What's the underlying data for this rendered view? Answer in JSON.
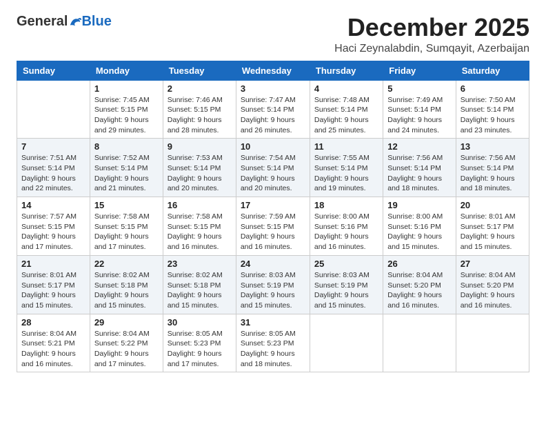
{
  "logo": {
    "general": "General",
    "blue": "Blue"
  },
  "header": {
    "month": "December 2025",
    "location": "Haci Zeynalabdin, Sumqayit, Azerbaijan"
  },
  "weekdays": [
    "Sunday",
    "Monday",
    "Tuesday",
    "Wednesday",
    "Thursday",
    "Friday",
    "Saturday"
  ],
  "weeks": [
    [
      {
        "day": "",
        "info": ""
      },
      {
        "day": "1",
        "info": "Sunrise: 7:45 AM\nSunset: 5:15 PM\nDaylight: 9 hours\nand 29 minutes."
      },
      {
        "day": "2",
        "info": "Sunrise: 7:46 AM\nSunset: 5:15 PM\nDaylight: 9 hours\nand 28 minutes."
      },
      {
        "day": "3",
        "info": "Sunrise: 7:47 AM\nSunset: 5:14 PM\nDaylight: 9 hours\nand 26 minutes."
      },
      {
        "day": "4",
        "info": "Sunrise: 7:48 AM\nSunset: 5:14 PM\nDaylight: 9 hours\nand 25 minutes."
      },
      {
        "day": "5",
        "info": "Sunrise: 7:49 AM\nSunset: 5:14 PM\nDaylight: 9 hours\nand 24 minutes."
      },
      {
        "day": "6",
        "info": "Sunrise: 7:50 AM\nSunset: 5:14 PM\nDaylight: 9 hours\nand 23 minutes."
      }
    ],
    [
      {
        "day": "7",
        "info": "Sunrise: 7:51 AM\nSunset: 5:14 PM\nDaylight: 9 hours\nand 22 minutes."
      },
      {
        "day": "8",
        "info": "Sunrise: 7:52 AM\nSunset: 5:14 PM\nDaylight: 9 hours\nand 21 minutes."
      },
      {
        "day": "9",
        "info": "Sunrise: 7:53 AM\nSunset: 5:14 PM\nDaylight: 9 hours\nand 20 minutes."
      },
      {
        "day": "10",
        "info": "Sunrise: 7:54 AM\nSunset: 5:14 PM\nDaylight: 9 hours\nand 20 minutes."
      },
      {
        "day": "11",
        "info": "Sunrise: 7:55 AM\nSunset: 5:14 PM\nDaylight: 9 hours\nand 19 minutes."
      },
      {
        "day": "12",
        "info": "Sunrise: 7:56 AM\nSunset: 5:14 PM\nDaylight: 9 hours\nand 18 minutes."
      },
      {
        "day": "13",
        "info": "Sunrise: 7:56 AM\nSunset: 5:14 PM\nDaylight: 9 hours\nand 18 minutes."
      }
    ],
    [
      {
        "day": "14",
        "info": "Sunrise: 7:57 AM\nSunset: 5:15 PM\nDaylight: 9 hours\nand 17 minutes."
      },
      {
        "day": "15",
        "info": "Sunrise: 7:58 AM\nSunset: 5:15 PM\nDaylight: 9 hours\nand 17 minutes."
      },
      {
        "day": "16",
        "info": "Sunrise: 7:58 AM\nSunset: 5:15 PM\nDaylight: 9 hours\nand 16 minutes."
      },
      {
        "day": "17",
        "info": "Sunrise: 7:59 AM\nSunset: 5:15 PM\nDaylight: 9 hours\nand 16 minutes."
      },
      {
        "day": "18",
        "info": "Sunrise: 8:00 AM\nSunset: 5:16 PM\nDaylight: 9 hours\nand 16 minutes."
      },
      {
        "day": "19",
        "info": "Sunrise: 8:00 AM\nSunset: 5:16 PM\nDaylight: 9 hours\nand 15 minutes."
      },
      {
        "day": "20",
        "info": "Sunrise: 8:01 AM\nSunset: 5:17 PM\nDaylight: 9 hours\nand 15 minutes."
      }
    ],
    [
      {
        "day": "21",
        "info": "Sunrise: 8:01 AM\nSunset: 5:17 PM\nDaylight: 9 hours\nand 15 minutes."
      },
      {
        "day": "22",
        "info": "Sunrise: 8:02 AM\nSunset: 5:18 PM\nDaylight: 9 hours\nand 15 minutes."
      },
      {
        "day": "23",
        "info": "Sunrise: 8:02 AM\nSunset: 5:18 PM\nDaylight: 9 hours\nand 15 minutes."
      },
      {
        "day": "24",
        "info": "Sunrise: 8:03 AM\nSunset: 5:19 PM\nDaylight: 9 hours\nand 15 minutes."
      },
      {
        "day": "25",
        "info": "Sunrise: 8:03 AM\nSunset: 5:19 PM\nDaylight: 9 hours\nand 15 minutes."
      },
      {
        "day": "26",
        "info": "Sunrise: 8:04 AM\nSunset: 5:20 PM\nDaylight: 9 hours\nand 16 minutes."
      },
      {
        "day": "27",
        "info": "Sunrise: 8:04 AM\nSunset: 5:20 PM\nDaylight: 9 hours\nand 16 minutes."
      }
    ],
    [
      {
        "day": "28",
        "info": "Sunrise: 8:04 AM\nSunset: 5:21 PM\nDaylight: 9 hours\nand 16 minutes."
      },
      {
        "day": "29",
        "info": "Sunrise: 8:04 AM\nSunset: 5:22 PM\nDaylight: 9 hours\nand 17 minutes."
      },
      {
        "day": "30",
        "info": "Sunrise: 8:05 AM\nSunset: 5:23 PM\nDaylight: 9 hours\nand 17 minutes."
      },
      {
        "day": "31",
        "info": "Sunrise: 8:05 AM\nSunset: 5:23 PM\nDaylight: 9 hours\nand 18 minutes."
      },
      {
        "day": "",
        "info": ""
      },
      {
        "day": "",
        "info": ""
      },
      {
        "day": "",
        "info": ""
      }
    ]
  ]
}
